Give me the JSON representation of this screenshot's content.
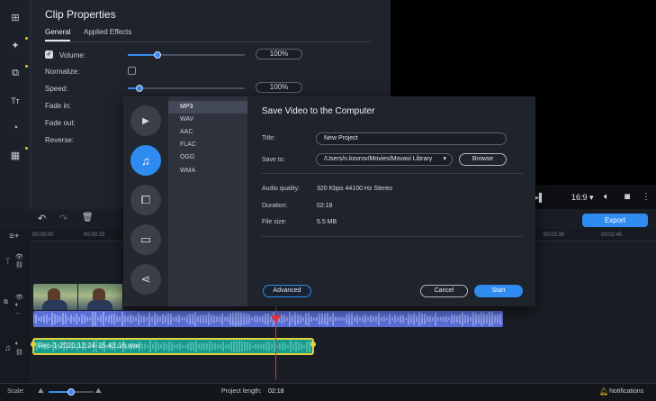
{
  "toolbar": {
    "tools": [
      {
        "icon": "import-icon",
        "glyph": "⊞"
      },
      {
        "icon": "magic-wand-icon",
        "glyph": "✦"
      },
      {
        "icon": "transitions-icon",
        "glyph": "⧉"
      },
      {
        "icon": "titles-icon",
        "glyph": "Tт"
      },
      {
        "icon": "stickers-icon",
        "glyph": "◔"
      },
      {
        "icon": "more-tools-icon",
        "glyph": "▦"
      }
    ]
  },
  "clip_properties": {
    "title": "Clip Properties",
    "tabs": [
      "General",
      "Applied Effects"
    ],
    "rows": {
      "volume": {
        "label": "Volume:",
        "value": "100%",
        "level": 0.25,
        "checked": true
      },
      "normalize": {
        "label": "Normalize:"
      },
      "speed": {
        "label": "Speed:",
        "value": "100%",
        "level": 0.1
      },
      "fade_in": {
        "label": "Fade in:"
      },
      "fade_out": {
        "label": "Fade out:"
      },
      "reverse": {
        "label": "Reverse:"
      }
    }
  },
  "player": {
    "aspect_ratio": "16:9",
    "play_icon": "play-icon",
    "volume_icon": "speaker-icon",
    "snapshot_icon": "camera-icon",
    "more_icon": "more-vertical-icon"
  },
  "export_button": "Export",
  "timeline": {
    "ruler_labels": [
      "00:00:00",
      "00:00:15",
      "00:02:30",
      "00:02:45"
    ],
    "audio_clip_name": "Rec-1-2020.12.24-15.43.16.wav"
  },
  "status_bar": {
    "scale_label": "Scale:",
    "project_length_label": "Project length:",
    "project_length_value": "02:18",
    "notifications": "Notifications",
    "scale_level": 0.5
  },
  "dialog": {
    "title": "Save Video to the Computer",
    "formats": [
      "MP3",
      "WAV",
      "AAC",
      "FLAC",
      "OGG",
      "WMA"
    ],
    "selected_format": "MP3",
    "categories": [
      {
        "icon": "video-icon",
        "glyph": "▶"
      },
      {
        "icon": "music-note-icon",
        "glyph": "♫"
      },
      {
        "icon": "devices-icon",
        "glyph": "⧠"
      },
      {
        "icon": "tv-icon",
        "glyph": "▭"
      },
      {
        "icon": "share-icon",
        "glyph": "⋖"
      }
    ],
    "title_label": "Title:",
    "title_value": "New Project",
    "save_to_label": "Save to:",
    "save_to_value": "/Users/n.kovrov/Movies/Movavi Library",
    "browse": "Browse",
    "audio_quality_label": "Audio quality:",
    "audio_quality_value": "320 Kbps 44100 Hz Stereo",
    "duration_label": "Duration:",
    "duration_value": "02:18",
    "file_size_label": "File size:",
    "file_size_value": "5.5 MB",
    "advanced": "Advanced",
    "cancel": "Cancel",
    "start": "Start"
  },
  "colors": {
    "accent": "#2e8cf0",
    "audio_clip": "#169b8d",
    "audio_clip_border": "#e2d23b",
    "waveform": "#5a6fd8",
    "playhead": "#e0323c"
  }
}
